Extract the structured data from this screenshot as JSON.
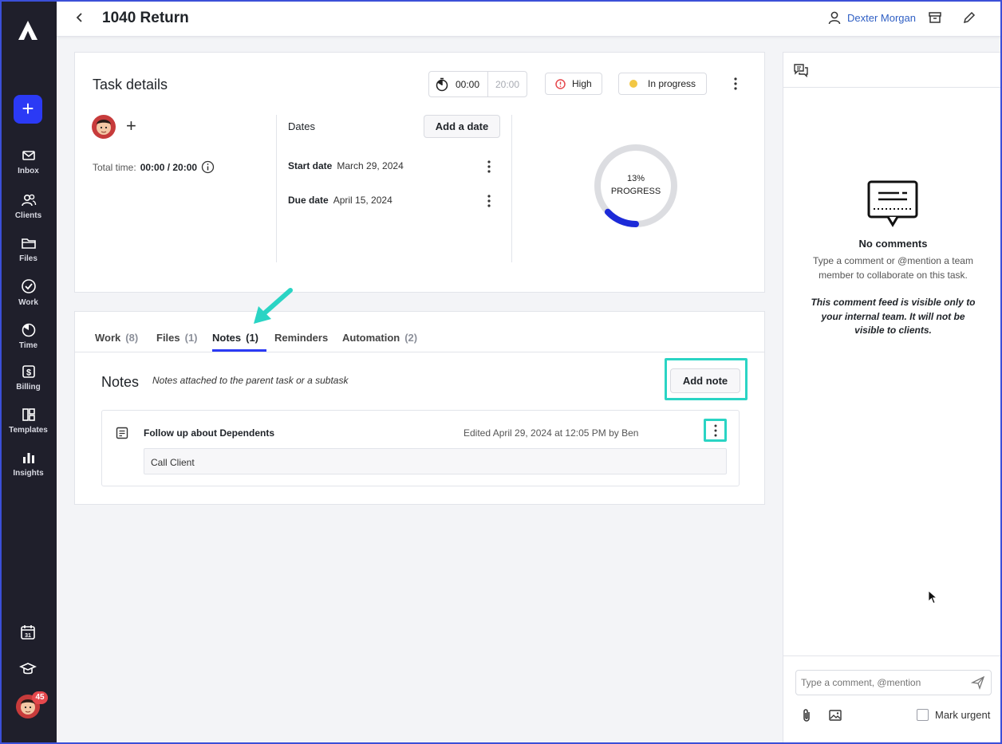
{
  "app": {
    "page_title": "1040 Return",
    "user_name": "Dexter Morgan"
  },
  "sidebar": {
    "items": [
      {
        "label": "Inbox",
        "icon": "mail-icon"
      },
      {
        "label": "Clients",
        "icon": "users-icon"
      },
      {
        "label": "Files",
        "icon": "folder-icon"
      },
      {
        "label": "Work",
        "icon": "check-circle-icon"
      },
      {
        "label": "Time",
        "icon": "timer-icon"
      },
      {
        "label": "Billing",
        "icon": "dollar-icon"
      },
      {
        "label": "Templates",
        "icon": "layout-icon"
      },
      {
        "label": "Insights",
        "icon": "bar-chart-icon"
      }
    ],
    "calendar_day": "31",
    "notification_count": "45",
    "new_button": "+"
  },
  "task": {
    "title": "Task details",
    "timer_elapsed": "00:00",
    "timer_budget": "20:00",
    "priority": "High",
    "status": "In progress",
    "total_time_label": "Total time:",
    "total_time_value": "00:00 / 20:00",
    "dates_label": "Dates",
    "add_date_label": "Add a date",
    "start_date_label": "Start date",
    "start_date": "March 29, 2024",
    "due_date_label": "Due date",
    "due_date": "April 15, 2024",
    "progress_percent": "13%",
    "progress_label": "PROGRESS",
    "progress_value": 0.13
  },
  "tabs": [
    {
      "label": "Work",
      "count": "(8)"
    },
    {
      "label": "Files",
      "count": "(1)"
    },
    {
      "label": "Notes",
      "count": "(1)"
    },
    {
      "label": "Reminders",
      "count": ""
    },
    {
      "label": "Automation",
      "count": "(2)"
    }
  ],
  "notes": {
    "title": "Notes",
    "subtitle": "Notes attached to the parent task or a subtask",
    "add_button": "Add note",
    "items": [
      {
        "title": "Follow up about Dependents",
        "meta": "Edited April 29, 2024 at 12:05 PM by Ben",
        "body": "Call Client"
      }
    ]
  },
  "comments": {
    "empty_title": "No comments",
    "empty_desc": "Type a comment or @mention a team member to collaborate on this task.",
    "visibility_note": "This comment feed is visible only to your internal team. It will not be visible to clients.",
    "input_placeholder": "Type a comment, @mention",
    "mark_urgent": "Mark urgent"
  },
  "colors": {
    "accent": "#2b3af5",
    "highlight": "#2ad4c4",
    "priority": "#e5484d",
    "status": "#f2c744",
    "sidebar": "#1f1f2b"
  }
}
